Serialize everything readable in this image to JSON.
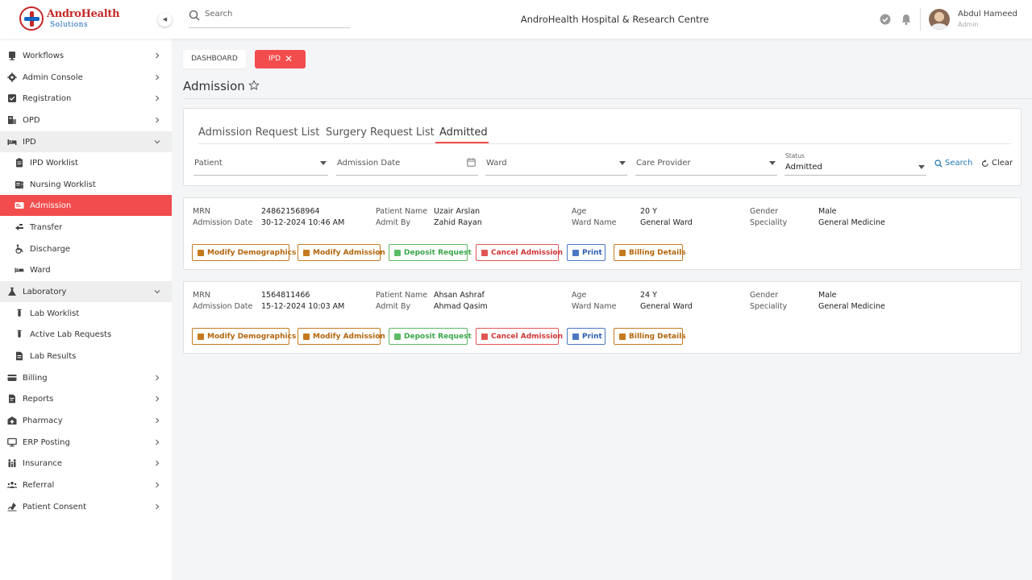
{
  "header": {
    "logo_name": "AndroHealth",
    "logo_sub": "Solutions",
    "search_placeholder": "Search",
    "hospital_name": "AndroHealth Hospital & Research Centre",
    "user_name": "Abdul Hameed",
    "user_role": "Admin"
  },
  "sidebar": {
    "items": [
      {
        "label": "Workflows",
        "icon": "workflow-icon"
      },
      {
        "label": "Admin Console",
        "icon": "gear-icon"
      },
      {
        "label": "Registration",
        "icon": "registration-icon"
      },
      {
        "label": "OPD",
        "icon": "opd-icon"
      },
      {
        "label": "IPD",
        "icon": "bed-icon"
      },
      {
        "label": "IPD Worklist",
        "icon": "clipboard-icon"
      },
      {
        "label": "Nursing Worklist",
        "icon": "nurse-icon"
      },
      {
        "label": "Admission",
        "icon": "admission-icon"
      },
      {
        "label": "Transfer",
        "icon": "transfer-icon"
      },
      {
        "label": "Discharge",
        "icon": "wheelchair-icon"
      },
      {
        "label": "Ward",
        "icon": "ward-icon"
      },
      {
        "label": "Laboratory",
        "icon": "flask-icon"
      },
      {
        "label": "Lab Worklist",
        "icon": "test-tube-icon"
      },
      {
        "label": "Active Lab Requests",
        "icon": "test-tube-icon"
      },
      {
        "label": "Lab Results",
        "icon": "document-icon"
      },
      {
        "label": "Billing",
        "icon": "card-icon"
      },
      {
        "label": "Reports",
        "icon": "report-icon"
      },
      {
        "label": "Pharmacy",
        "icon": "pharmacy-icon"
      },
      {
        "label": "ERP Posting",
        "icon": "monitor-icon"
      },
      {
        "label": "Insurance",
        "icon": "family-icon"
      },
      {
        "label": "Referral",
        "icon": "group-icon"
      },
      {
        "label": "Patient Consent",
        "icon": "consent-icon"
      }
    ]
  },
  "tabs": {
    "dashboard": "DASHBOARD",
    "ipd": "IPD",
    "close_glyph": "✕"
  },
  "page": {
    "title": "Admission"
  },
  "subtabs": [
    "Admission Request List",
    "Surgery Request List",
    "Admitted"
  ],
  "filters": {
    "patient": "Patient",
    "admission_date": "Admission Date",
    "ward": "Ward",
    "care_provider": "Care Provider",
    "status_caption": "Status",
    "status_value": "Admitted",
    "search_label": "Search",
    "clear_label": "Clear"
  },
  "labels": {
    "mrn": "MRN",
    "admission_date": "Admission Date",
    "patient_name": "Patient Name",
    "admit_by": "Admit By",
    "age": "Age",
    "ward_name": "Ward Name",
    "gender": "Gender",
    "speciality": "Speciality"
  },
  "actions": {
    "modify_demographics": "Modify Demographics",
    "modify_admission": "Modify Admission",
    "deposit_request": "Deposit Request",
    "cancel_admission": "Cancel Admission",
    "print": "Print",
    "billing_details": "Billing Details"
  },
  "patients": [
    {
      "mrn": "248621568964",
      "admission_date": "30-12-2024 10:46 AM",
      "patient_name": "Uzair Arslan",
      "admit_by": "Zahid Rayan",
      "age": "20 Y",
      "ward_name": "General Ward",
      "gender": "Male",
      "speciality": "General Medicine"
    },
    {
      "mrn": "1564811466",
      "admission_date": "15-12-2024 10:03 AM",
      "patient_name": "Ahsan Ashraf",
      "admit_by": "Ahmad Qasim",
      "age": "24 Y",
      "ward_name": "General Ward",
      "gender": "Male",
      "speciality": "General Medicine"
    }
  ],
  "colors": {
    "accent": "#f24c4c",
    "brand_red": "#c62828",
    "brand_blue": "#1565c0",
    "link_blue": "#1f78b4"
  }
}
